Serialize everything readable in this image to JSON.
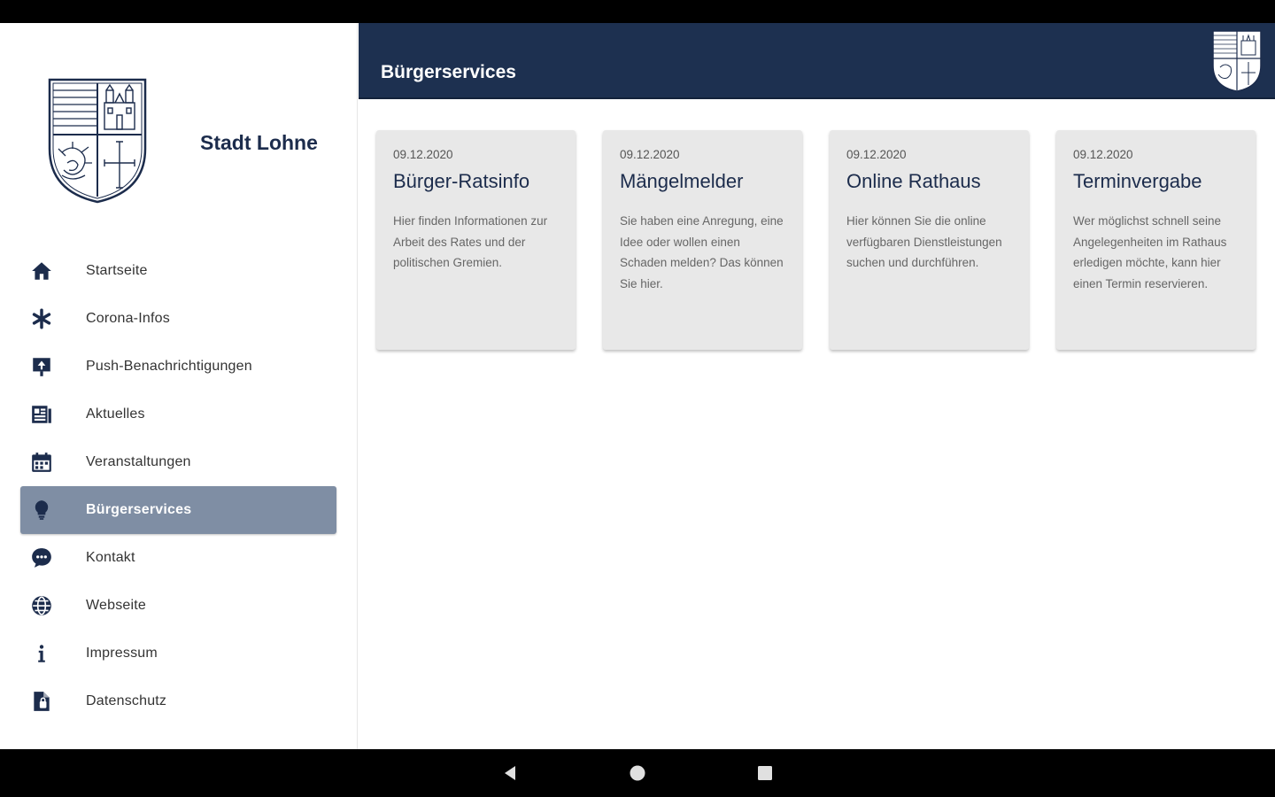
{
  "app": {
    "city_name": "Stadt Lohne"
  },
  "sidebar": {
    "items": [
      {
        "label": "Startseite",
        "icon": "home-icon"
      },
      {
        "label": "Corona-Infos",
        "icon": "asterisk-icon"
      },
      {
        "label": "Push-Benachrichtigungen",
        "icon": "push-notification-icon"
      },
      {
        "label": "Aktuelles",
        "icon": "newspaper-icon"
      },
      {
        "label": "Veranstaltungen",
        "icon": "calendar-icon"
      },
      {
        "label": "Bürgerservices",
        "icon": "lightbulb-icon",
        "active": true
      },
      {
        "label": "Kontakt",
        "icon": "chat-icon"
      },
      {
        "label": "Webseite",
        "icon": "globe-icon"
      },
      {
        "label": "Impressum",
        "icon": "info-icon"
      },
      {
        "label": "Datenschutz",
        "icon": "document-icon"
      }
    ]
  },
  "header": {
    "title": "Bürgerservices"
  },
  "cards": [
    {
      "date": "09.12.2020",
      "title": "Bürger-Ratsinfo",
      "text": "Hier finden Informationen zur Arbeit des Rates und der politischen Gremien."
    },
    {
      "date": "09.12.2020",
      "title": "Mängelmelder",
      "text": "Sie haben eine Anregung, eine Idee oder wollen einen Schaden melden? Das können Sie hier."
    },
    {
      "date": "09.12.2020",
      "title": "Online Rathaus",
      "text": "Hier können Sie die online verfügbaren Dienstleistungen suchen und durchführen."
    },
    {
      "date": "09.12.2020",
      "title": "Terminvergabe",
      "text": "Wer möglichst schnell seine Angelegenheiten im Rathaus erledigen möchte, kann hier einen Termin reservieren."
    }
  ],
  "colors": {
    "primary": "#1d3050",
    "active_nav": "#7f8ea4",
    "card_bg": "#e8e8e8",
    "icon": "#1c2c4c"
  }
}
